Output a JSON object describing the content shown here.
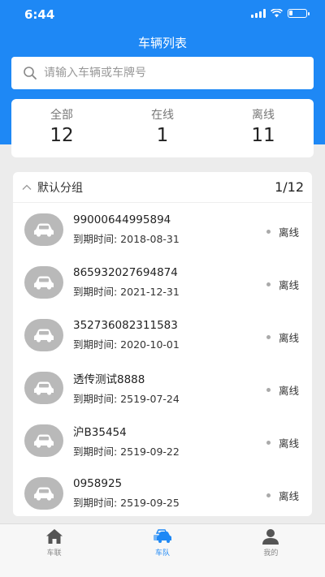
{
  "status_bar": {
    "time": "6:44"
  },
  "nav": {
    "title": "车辆列表"
  },
  "search": {
    "placeholder": "请输入车辆或车牌号"
  },
  "stats": [
    {
      "label": "全部",
      "value": "12"
    },
    {
      "label": "在线",
      "value": "1"
    },
    {
      "label": "离线",
      "value": "11"
    }
  ],
  "group": {
    "title": "默认分组",
    "count": "1/12",
    "vehicles": [
      {
        "id": "99000644995894",
        "expiry": "到期时间: 2018-08-31",
        "status": "离线"
      },
      {
        "id": "865932027694874",
        "expiry": "到期时间: 2021-12-31",
        "status": "离线"
      },
      {
        "id": "352736082311583",
        "expiry": "到期时间: 2020-10-01",
        "status": "离线"
      },
      {
        "id": "透传测试8888",
        "expiry": "到期时间: 2519-07-24",
        "status": "离线"
      },
      {
        "id": "沪B35454",
        "expiry": "到期时间: 2519-09-22",
        "status": "离线"
      },
      {
        "id": "0958925",
        "expiry": "到期时间: 2519-09-25",
        "status": "离线"
      }
    ]
  },
  "tabs": [
    {
      "label": "车联",
      "icon": "home-icon"
    },
    {
      "label": "车队",
      "icon": "car-icon"
    },
    {
      "label": "我的",
      "icon": "person-icon"
    }
  ],
  "colors": {
    "primary": "#1e88f5",
    "avatar_bg": "#b9b9b9",
    "offline_dot": "#aaaaaa"
  }
}
